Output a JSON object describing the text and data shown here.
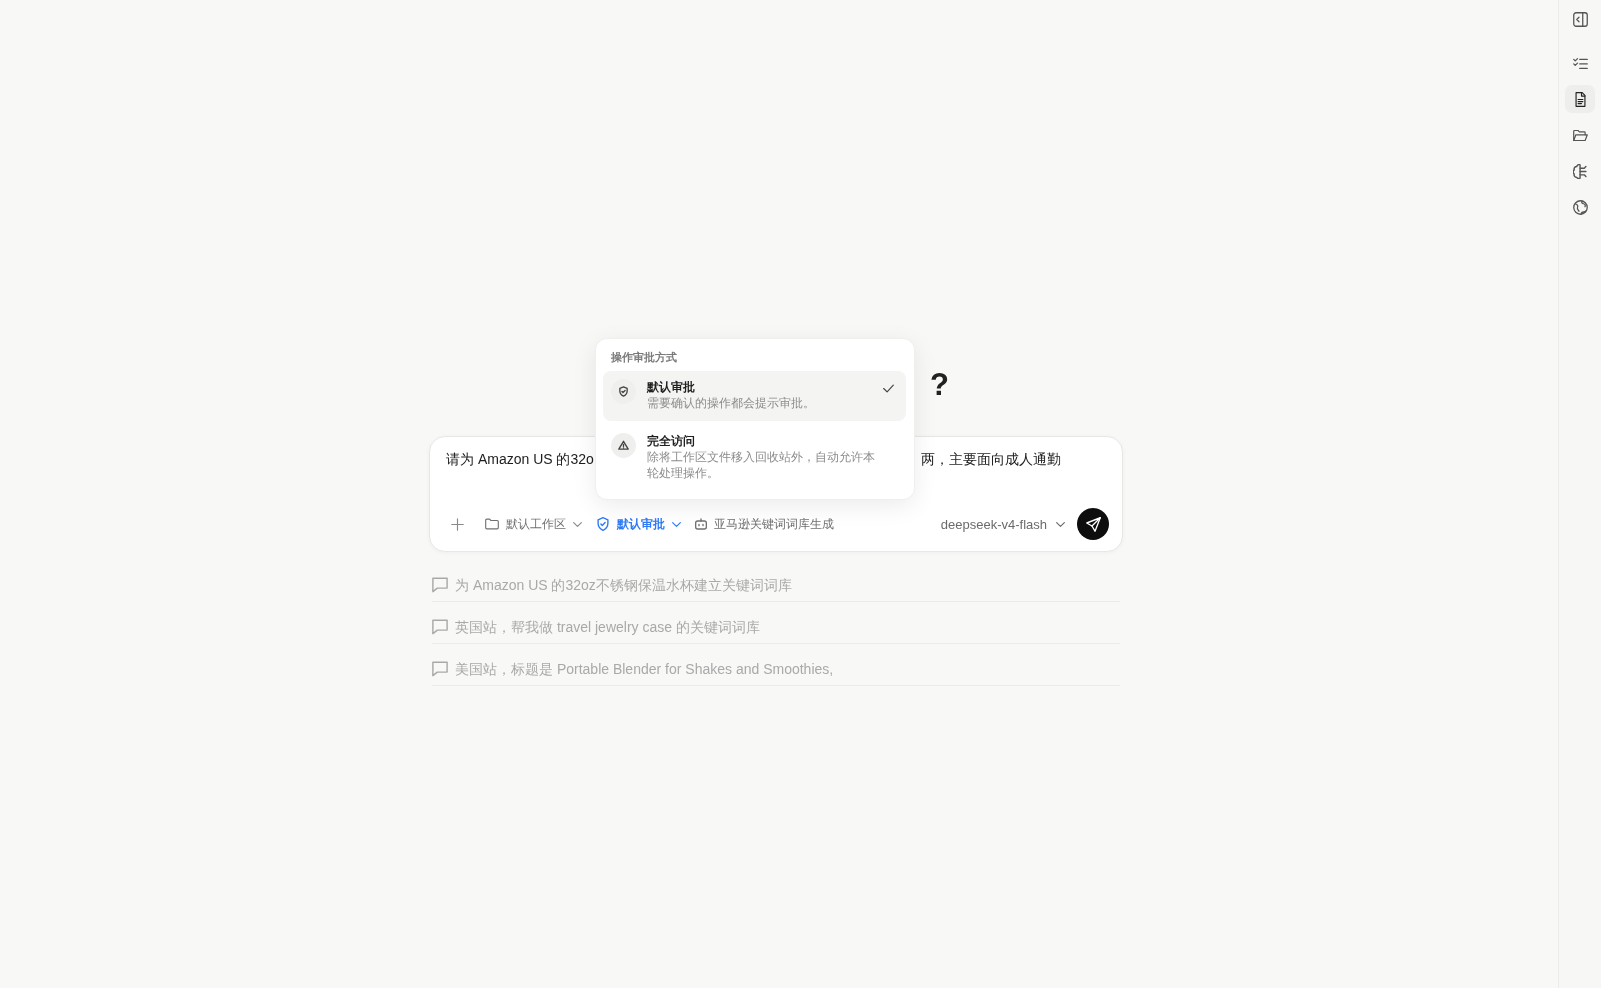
{
  "sidebar": {
    "items": [
      {
        "kind": "toggle",
        "selected": false
      },
      {
        "kind": "checklist",
        "selected": false
      },
      {
        "kind": "document",
        "selected": true
      },
      {
        "kind": "folder",
        "selected": false
      },
      {
        "kind": "brain",
        "selected": false
      },
      {
        "kind": "globe",
        "selected": false
      }
    ]
  },
  "heading": "?",
  "composer": {
    "prompt_fragments": [
      "请为 Amazon US 的32o",
      "两，主要面向成人通勤"
    ],
    "workspace": {
      "label": "默认工作区",
      "expanded": false
    },
    "approval": {
      "label": "默认审批",
      "expanded": true
    },
    "skill": {
      "label": "亚马逊关键词词库生成"
    },
    "model": {
      "label": "deepseek-v4-flash"
    }
  },
  "approval_menu": {
    "title": "操作审批方式",
    "options": [
      {
        "kind": "shield",
        "title": "默认审批",
        "description": "需要确认的操作都会提示审批。",
        "selected": true
      },
      {
        "kind": "warning",
        "title": "完全访问",
        "description": "除将工作区文件移入回收站外，自动允许本轮处理操作。",
        "selected": false
      }
    ]
  },
  "suggestions": [
    "为 Amazon US 的32oz不锈钢保温水杯建立关键词词库",
    "英国站，帮我做 travel jewelry case 的关键词词库",
    "美国站，标题是 Portable Blender for Shakes and Smoothies,"
  ]
}
